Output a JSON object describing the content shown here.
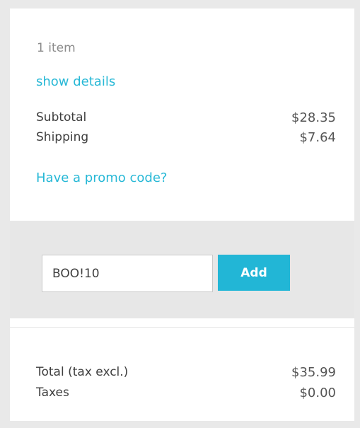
{
  "summary": {
    "items_count": "1 item",
    "show_details": "show details",
    "subtotal_label": "Subtotal",
    "subtotal_value": "$28.35",
    "shipping_label": "Shipping",
    "shipping_value": "$7.64",
    "promo_link": "Have a promo code?"
  },
  "promo": {
    "input_value": "BOO!10",
    "add_label": "Add"
  },
  "totals": {
    "total_label": "Total (tax excl.)",
    "total_value": "$35.99",
    "taxes_label": "Taxes",
    "taxes_value": "$0.00"
  },
  "colors": {
    "accent": "#22b6d6",
    "background": "#e9e9e9",
    "promo_band": "#e7e7e7"
  }
}
